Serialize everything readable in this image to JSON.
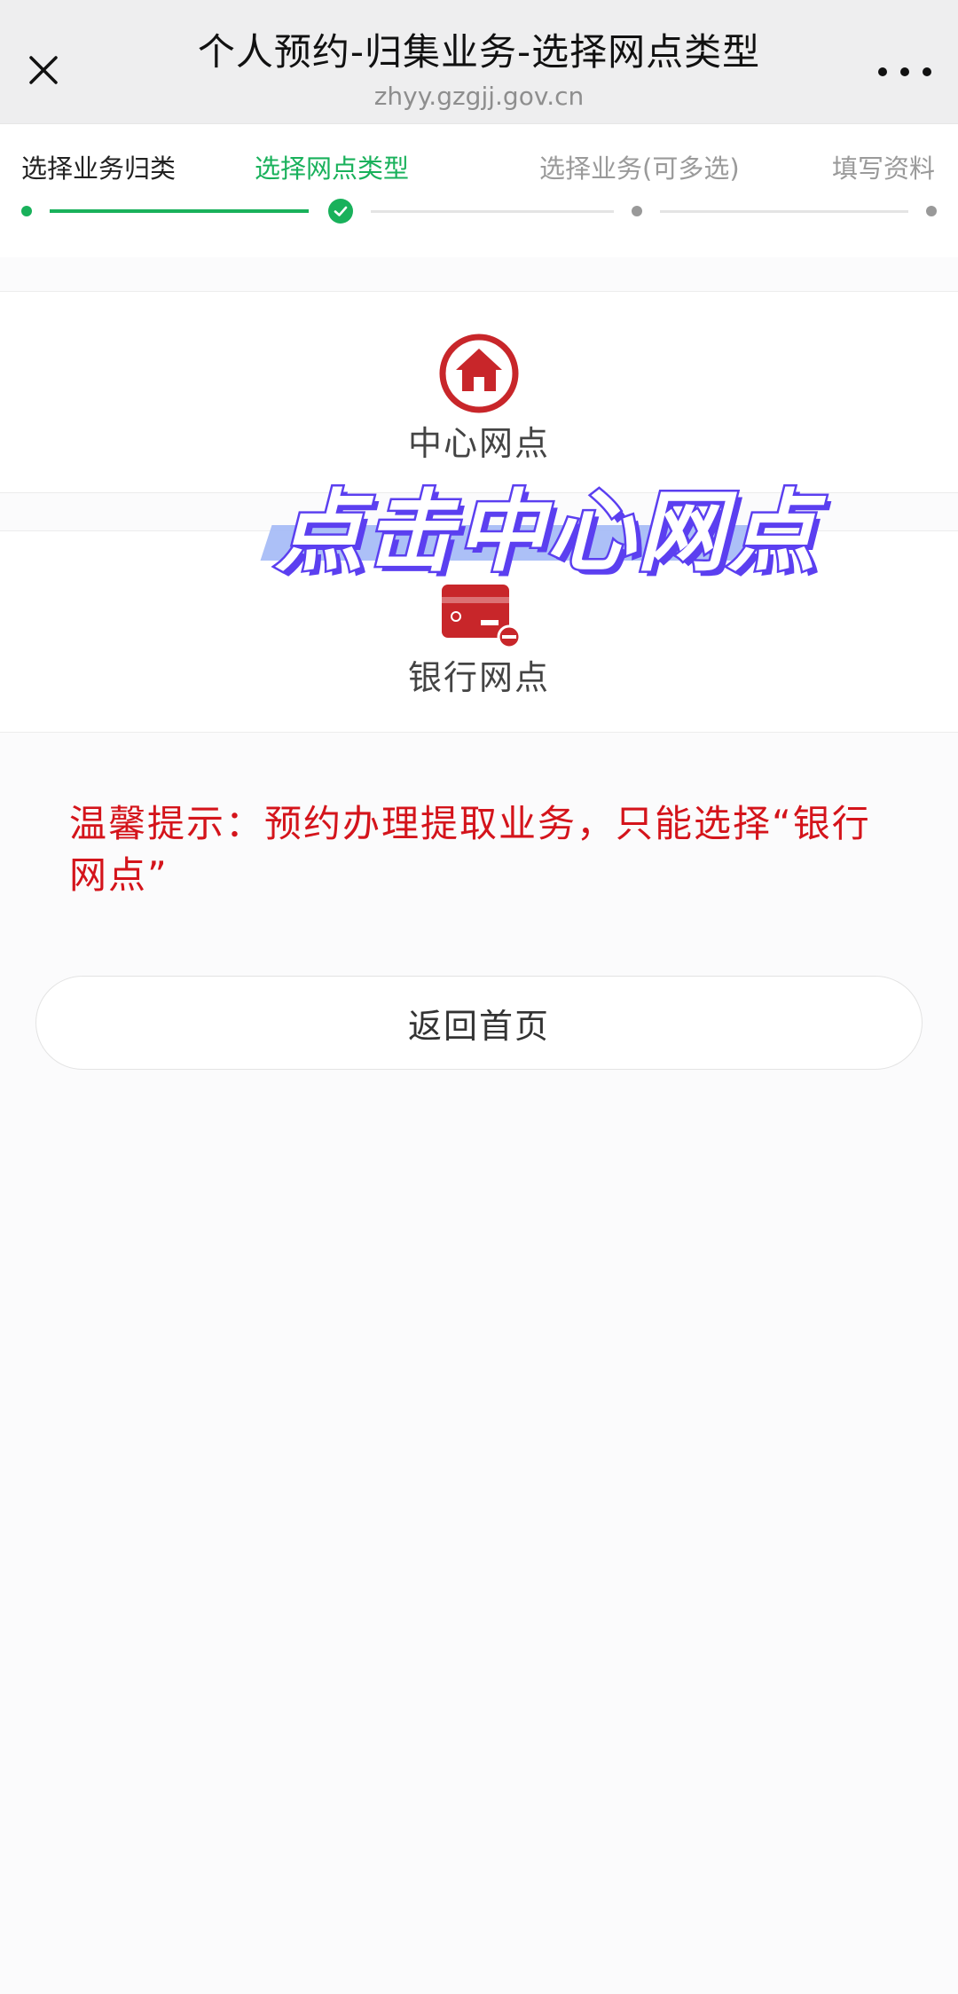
{
  "header": {
    "title": "个人预约-归集业务-选择网点类型",
    "url": "zhyy.gzgjj.gov.cn",
    "close_icon": "close-icon",
    "more_icon": "more-dots-icon"
  },
  "steps": [
    {
      "label": "选择业务归类",
      "state": "done"
    },
    {
      "label": "选择网点类型",
      "state": "active"
    },
    {
      "label": "选择业务(可多选)",
      "state": "todo"
    },
    {
      "label": "填写资料",
      "state": "todo"
    }
  ],
  "options": {
    "center": {
      "label": "中心网点",
      "icon": "home-icon"
    },
    "bank": {
      "label": "银行网点",
      "icon": "bank-card-icon"
    }
  },
  "overlay": {
    "caption": "点击中心网点"
  },
  "tip": {
    "text": "温馨提示：预约办理提取业务，只能选择“银行网点”"
  },
  "return_button": {
    "label": "返回首页"
  },
  "colors": {
    "accent_green": "#19b15b",
    "tip_red": "#d4141b",
    "icon_red": "#c8262a",
    "overlay_purple": "#5b3ff0"
  }
}
